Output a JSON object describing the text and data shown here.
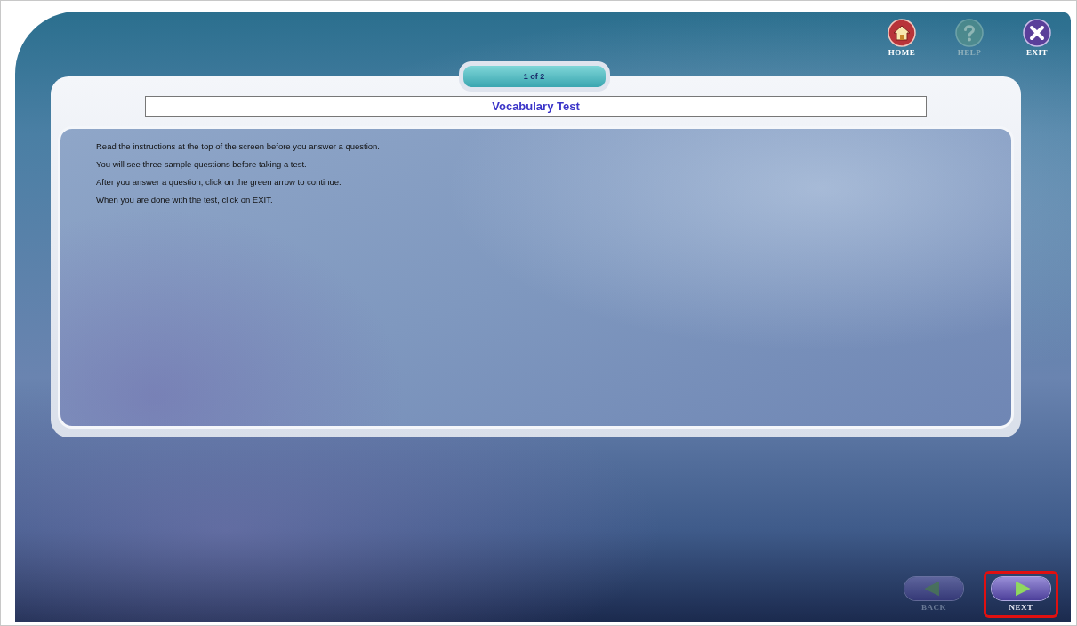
{
  "toolbar": [
    {
      "label": "HOME",
      "kind": "home",
      "disabled": false
    },
    {
      "label": "HELP",
      "kind": "help",
      "disabled": true
    },
    {
      "label": "EXIT",
      "kind": "exit",
      "disabled": false
    }
  ],
  "page_indicator": "1 of 2",
  "title": "Vocabulary Test",
  "instructions": [
    "Read the instructions at the top of the screen before you answer a question.",
    "You will see three sample questions before taking a test.",
    "After you answer a question, click on the green arrow to continue.",
    "When you are done with the test, click on EXIT."
  ],
  "navigation": [
    {
      "label": "BACK",
      "kind": "back",
      "disabled": true,
      "highlighted": false
    },
    {
      "label": "NEXT",
      "kind": "next",
      "disabled": false,
      "highlighted": true
    }
  ]
}
